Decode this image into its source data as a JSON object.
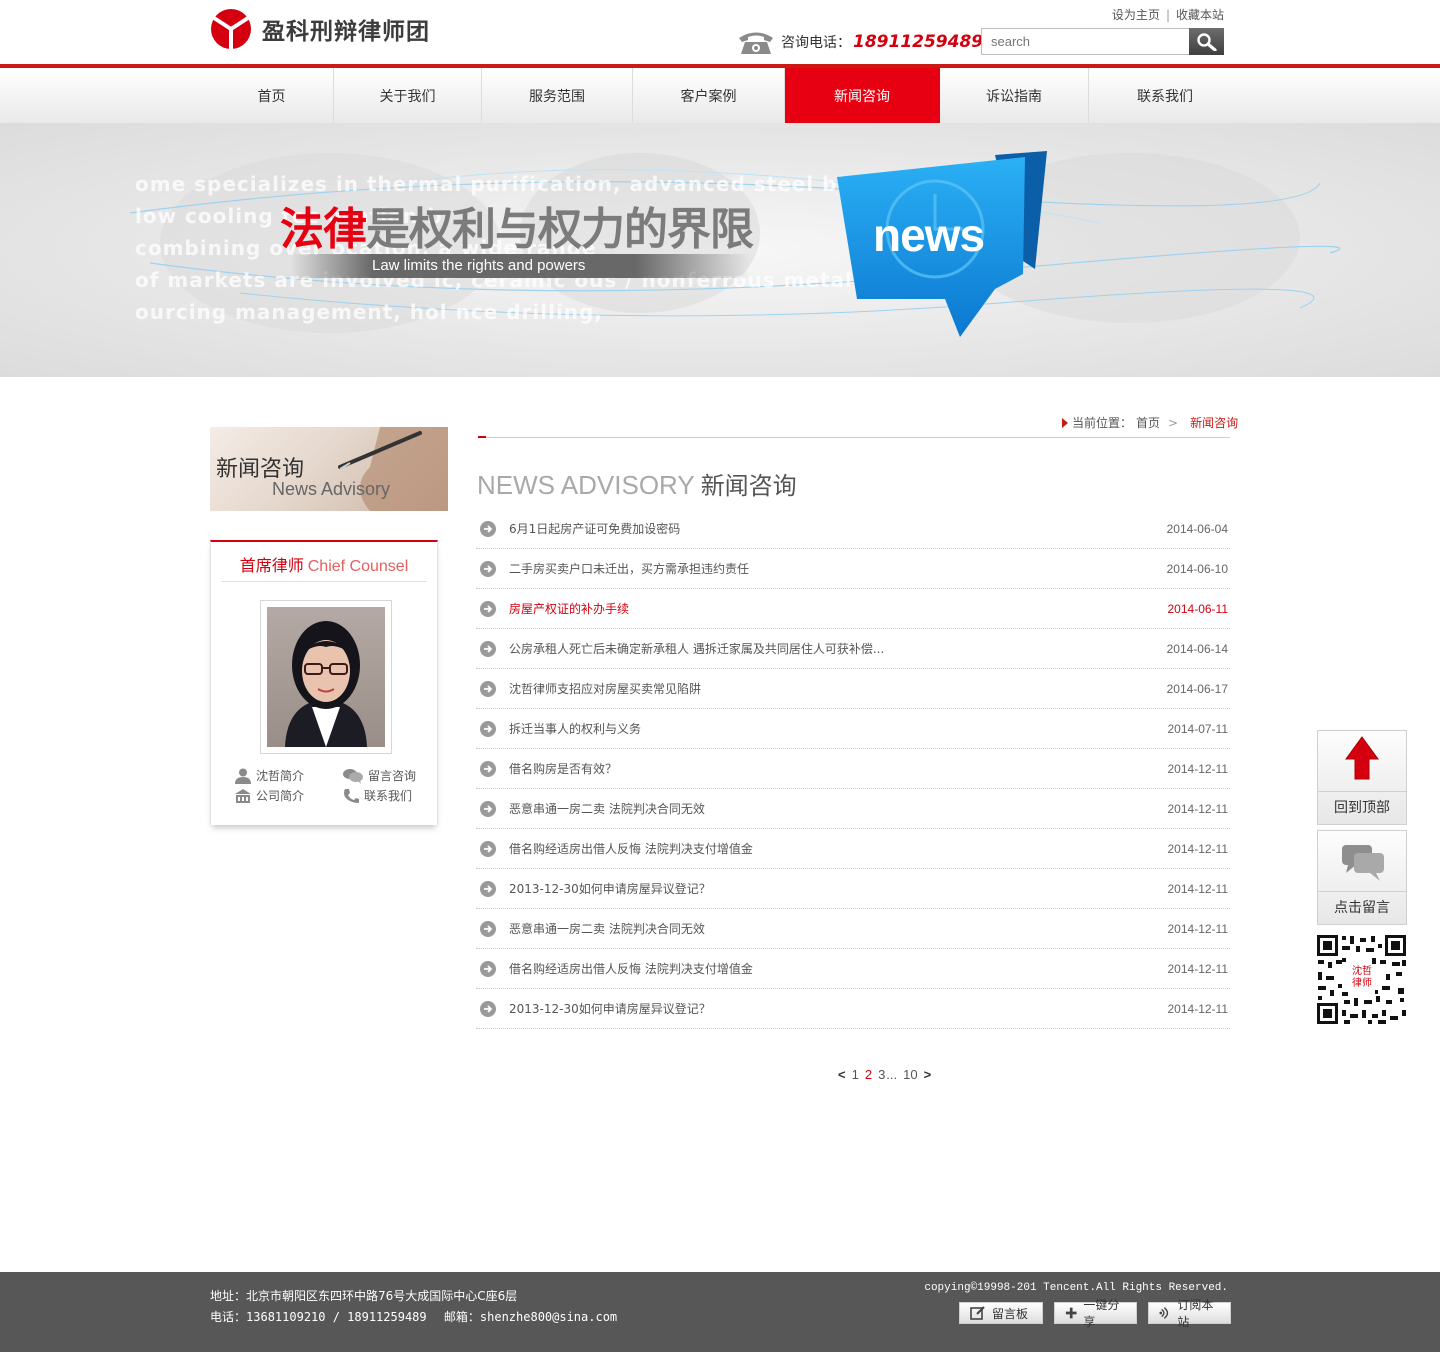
{
  "header": {
    "logo_text": "盈科刑辩律师团",
    "top_links": [
      "设为主页",
      "收藏本站"
    ],
    "hotline_label": "咨询电话：",
    "hotline_number": "18911259489",
    "search_placeholder": "search"
  },
  "nav": {
    "items": [
      {
        "label": "首页"
      },
      {
        "label": "关于我们"
      },
      {
        "label": "服务范围"
      },
      {
        "label": "客户案例"
      },
      {
        "label": "新闻咨询"
      },
      {
        "label": "诉讼指南"
      },
      {
        "label": "联系我们"
      }
    ],
    "active_index": 4
  },
  "banner": {
    "bg_text": [
      "ome specializes in thermal purification, advanced steel blending,",
      "low cooling tec                              ocation-b",
      "combining over                                         ocation, a wide range",
      "of markets are involved                  ic, ceramic           ous / nonferrous metallur",
      "ourcing management, hol                                                    nce drilling,"
    ],
    "slogan_red": "法律",
    "slogan_gray": "是权利与权力的界限",
    "slogan_sub": "Law limits the rights and powers",
    "badge_text": "news"
  },
  "sidebar": {
    "title_cn": "新闻咨询",
    "title_en": "News Advisory",
    "counsel_title_cn": "首席律师",
    "counsel_title_en": "Chief Counsel",
    "links": [
      {
        "label": "沈哲简介",
        "icon": "person-icon"
      },
      {
        "label": "留言咨询",
        "icon": "chat-icon"
      },
      {
        "label": "公司简介",
        "icon": "building-icon"
      },
      {
        "label": "联系我们",
        "icon": "phone-icon"
      }
    ]
  },
  "breadcrumb": {
    "label": "当前位置：",
    "home": "首页",
    "current": "新闻咨询"
  },
  "main": {
    "heading_en": "NEWS ADVISORY",
    "heading_cn": "新闻咨询",
    "news": [
      {
        "title": "6月1日起房产证可免费加设密码",
        "date": "2014-06-04",
        "highlight": false
      },
      {
        "title": "二手房买卖户口未迁出，买方需承担违约责任",
        "date": "2014-06-10",
        "highlight": false
      },
      {
        "title": "房屋产权证的补办手续",
        "date": "2014-06-11",
        "highlight": true
      },
      {
        "title": "公房承租人死亡后未确定新承租人 遇拆迁家属及共同居住人可获补偿...",
        "date": "2014-06-14",
        "highlight": false
      },
      {
        "title": "沈哲律师支招应对房屋买卖常见陷阱",
        "date": "2014-06-17",
        "highlight": false
      },
      {
        "title": "拆迁当事人的权利与义务",
        "date": "2014-07-11",
        "highlight": false
      },
      {
        "title": "借名购房是否有效？",
        "date": "2014-12-11",
        "highlight": false
      },
      {
        "title": "恶意串通一房二卖 法院判决合同无效",
        "date": "2014-12-11",
        "highlight": false
      },
      {
        "title": "借名购经适房出借人反悔 法院判决支付增值金",
        "date": "2014-12-11",
        "highlight": false
      },
      {
        "title": "2013-12-30如何申请房屋异议登记？",
        "date": "2014-12-11",
        "highlight": false
      },
      {
        "title": "恶意串通一房二卖 法院判决合同无效",
        "date": "2014-12-11",
        "highlight": false
      },
      {
        "title": "借名购经适房出借人反悔 法院判决支付增值金",
        "date": "2014-12-11",
        "highlight": false
      },
      {
        "title": "2013-12-30如何申请房屋异议登记？",
        "date": "2014-12-11",
        "highlight": false
      }
    ]
  },
  "pager": {
    "prev": "<",
    "pages": [
      "1",
      "2",
      "3"
    ],
    "current": "2",
    "ellipsis": "...",
    "last": "10",
    "next": ">"
  },
  "float_tools": {
    "back_to_top": "回到顶部",
    "leave_message": "点击留言",
    "qr_caption": "沈哲律师"
  },
  "footer": {
    "address": "地址：北京市朝阳区东四环中路76号大成国际中心C座6层",
    "phone_label": "电话：",
    "phones": "13681109210 / 18911259489",
    "email_label": "邮箱：",
    "email": "shenzhe800@sina.com",
    "copyright": "copying©19998-201 Tencent.All Rights Reserved.",
    "buttons": [
      {
        "label": "留言板",
        "icon": "edit-icon"
      },
      {
        "label": "一键分享",
        "icon": "plus-icon"
      },
      {
        "label": "订阅本站",
        "icon": "rss-icon"
      }
    ]
  },
  "colors": {
    "brand_red": "#e60012",
    "accent_red": "#d4000f",
    "nav_border": "#c91a15",
    "footer_bg": "#575757",
    "badge_blue": "#1e9ce8"
  }
}
